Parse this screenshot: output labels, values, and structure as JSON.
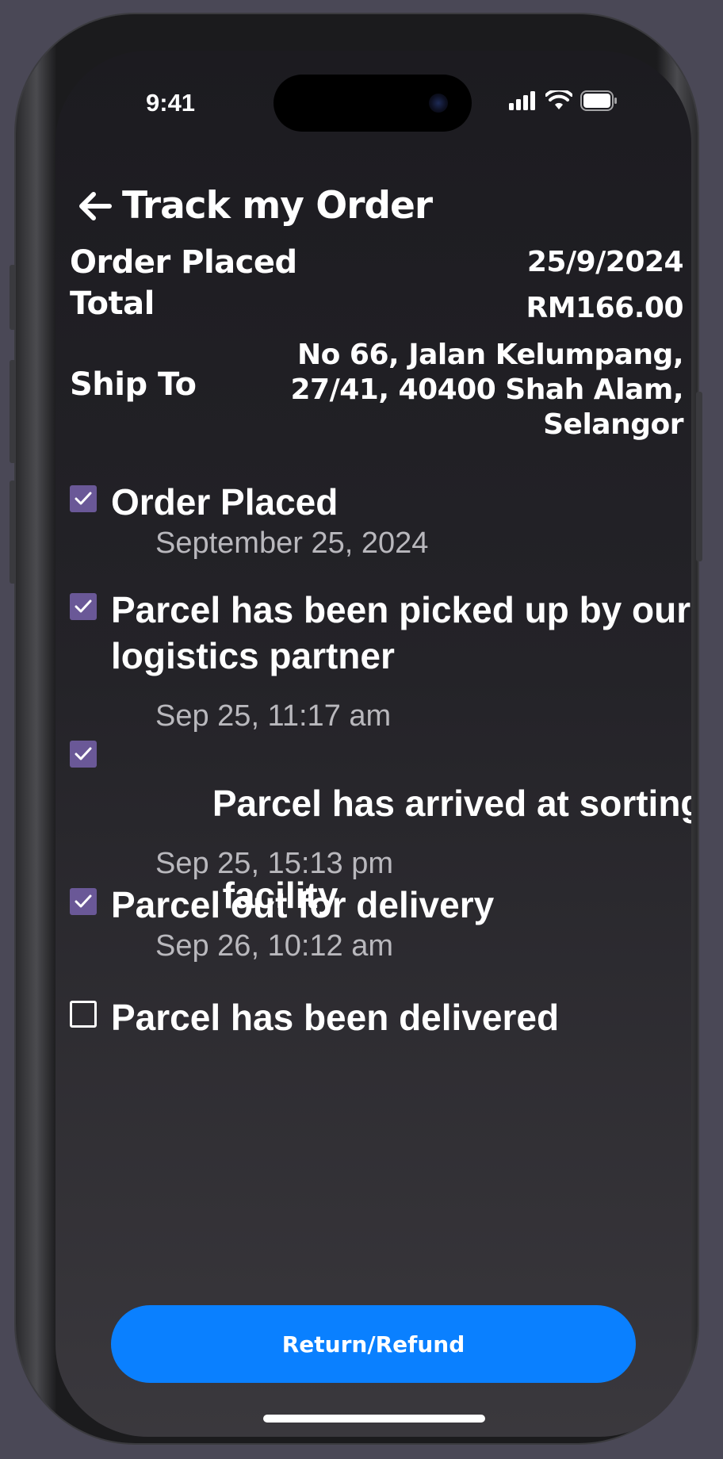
{
  "status_bar": {
    "time": "9:41",
    "signal_icon": "cellular-signal-icon",
    "wifi_icon": "wifi-icon",
    "battery_icon": "battery-icon"
  },
  "header": {
    "back_icon": "back-arrow-icon",
    "title": "Track my Order"
  },
  "order_info": {
    "placed_label": "Order Placed",
    "placed_value": "25/9/2024",
    "total_label": "Total",
    "total_value": "RM166.00",
    "ship_label": "Ship To",
    "ship_lines": [
      "No 66, Jalan Kelumpang,",
      "27/41, 40400 Shah Alam,",
      "Selangor"
    ]
  },
  "timeline": [
    {
      "title_lines": [
        "Order Placed"
      ],
      "time": "September 25, 2024",
      "checked": true
    },
    {
      "title_lines": [
        "Parcel has been picked up by our",
        "logistics partner"
      ],
      "time": "Sep 25, 11:17 am",
      "checked": true
    },
    {
      "title_lines": [
        "Parcel has arrived at sorting",
        " facility"
      ],
      "time": "Sep 25, 15:13 pm",
      "checked": true
    },
    {
      "title_lines": [
        "Parcel out for delivery"
      ],
      "time": "Sep 26, 10:12 am",
      "checked": true
    },
    {
      "title_lines": [
        "Parcel has been delivered"
      ],
      "checked": false
    }
  ],
  "actions": {
    "refund_label": "Return/Refund"
  },
  "colors": {
    "checkbox_checked": "#6a5897",
    "button_primary": "#0a80ff"
  }
}
